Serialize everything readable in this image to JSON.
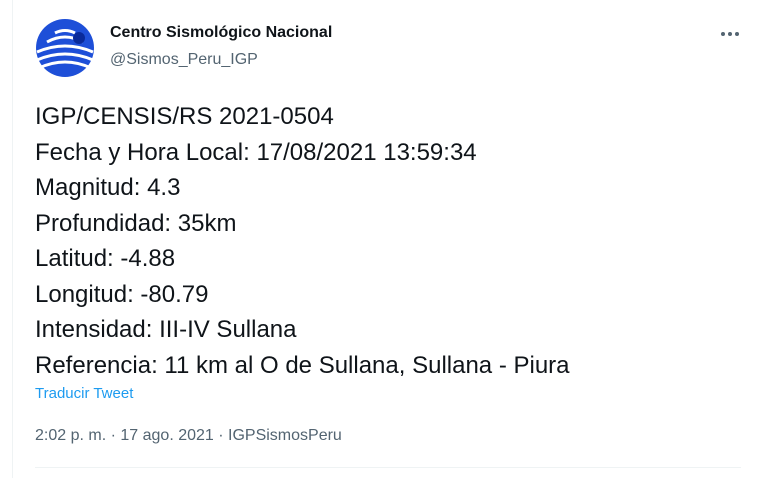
{
  "author": {
    "name": "Centro Sismológico Nacional",
    "handle": "@Sismos_Peru_IGP",
    "avatar_icon": "igp-logo-icon",
    "avatar_color": "#1e4fd8"
  },
  "more_icon": "more-options-icon",
  "tweet": {
    "lines": [
      "IGP/CENSIS/RS 2021-0504",
      "Fecha y Hora Local: 17/08/2021 13:59:34",
      "Magnitud: 4.3",
      "Profundidad: 35km",
      "Latitud: -4.88",
      "Longitud: -80.79",
      "Intensidad: III-IV Sullana",
      "Referencia: 11 km al O de Sullana, Sullana - Piura"
    ]
  },
  "translate_label": "Traducir Tweet",
  "meta": {
    "time": "2:02 p. m.",
    "sep1": " · ",
    "date": "17 ago. 2021",
    "sep2": " · ",
    "source": "IGPSismosPeru"
  },
  "colors": {
    "text": "#0f1419",
    "secondary": "#536471",
    "link": "#1d9bf0",
    "border": "#eff3f4"
  }
}
